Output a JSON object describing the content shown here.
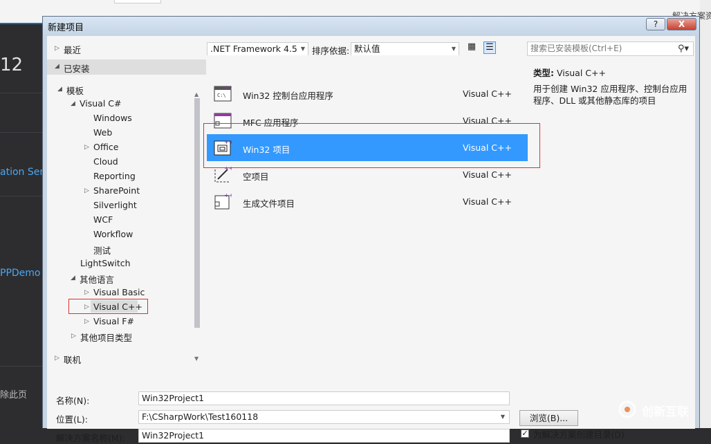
{
  "background": {
    "top_right_text": "解决方案资",
    "left_texts": [
      "12",
      "ation Serv",
      "PPDemo",
      "除此页"
    ]
  },
  "dialog": {
    "title": "新建项目",
    "help_label": "?",
    "close_label": "X"
  },
  "left_pane": {
    "recent": "最近",
    "installed": "已安装",
    "templates": "模板",
    "visual_csharp": "Visual C#",
    "csharp_children": [
      "Windows",
      "Web",
      "Office",
      "Cloud",
      "Reporting",
      "SharePoint",
      "Silverlight",
      "WCF",
      "Workflow",
      "测试"
    ],
    "lightswitch": "LightSwitch",
    "other_languages": "其他语言",
    "visual_basic": "Visual Basic",
    "visual_cpp": "Visual C++",
    "visual_fsharp": "Visual F#",
    "other_project_types": "其他项目类型",
    "online": "联机"
  },
  "toolbar": {
    "framework": ".NET Framework 4.5",
    "sort_label": "排序依据:",
    "sort_value": "默认值"
  },
  "search": {
    "placeholder": "搜索已安装模板(Ctrl+E)"
  },
  "templates": [
    {
      "name": "Win32 控制台应用程序",
      "lang": "Visual C++"
    },
    {
      "name": "MFC 应用程序",
      "lang": "Visual C++"
    },
    {
      "name": "Win32 项目",
      "lang": "Visual C++"
    },
    {
      "name": "空项目",
      "lang": "Visual C++"
    },
    {
      "name": "生成文件项目",
      "lang": "Visual C++"
    }
  ],
  "details": {
    "type_label": "类型:",
    "type_value": "Visual C++",
    "description": "用于创建 Win32 应用程序、控制台应用程序、DLL 或其他静态库的项目"
  },
  "form": {
    "name_label": "名称(N):",
    "name_value": "Win32Project1",
    "location_label": "位置(L):",
    "location_value": "F:\\CSharpWork\\Test160118",
    "solution_label": "解决方案名称(M):",
    "solution_value": "Win32Project1",
    "browse_label": "浏览(B)...",
    "create_dir_label": "为解决方案创建目录(D)",
    "create_dir_checked": "✓"
  },
  "watermark": {
    "text": "创新互联"
  },
  "colors": {
    "selection": "#3399ff",
    "highlight_box": "#d9322c"
  }
}
